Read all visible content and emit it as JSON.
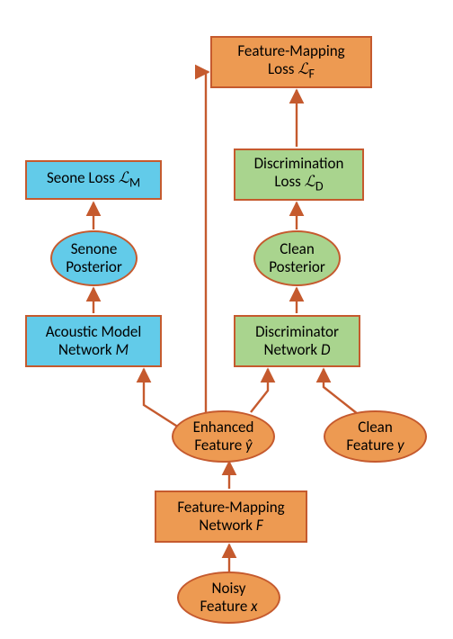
{
  "diagram": {
    "feature_mapping_loss": "Feature-Mapping\nLoss ℒ_F",
    "seone_loss": "Seone Loss ℒ_M",
    "discrimination_loss": "Discrimination\nLoss ℒ_D",
    "senone_posterior": "Senone\nPosterior",
    "clean_posterior": "Clean\nPosterior",
    "acoustic_model": "Acoustic Model\nNetwork M",
    "discriminator": "Discriminator\nNetwork D",
    "enhanced_feature": "Enhanced\nFeature ŷ",
    "clean_feature": "Clean\nFeature y",
    "feature_mapping_net": "Feature-Mapping\nNetwork F",
    "noisy_feature": "Noisy\nFeature x"
  },
  "colors": {
    "orange": "#ed9a52",
    "blue": "#62cbe9",
    "green": "#a9d48e",
    "border": "#c55a2e"
  }
}
